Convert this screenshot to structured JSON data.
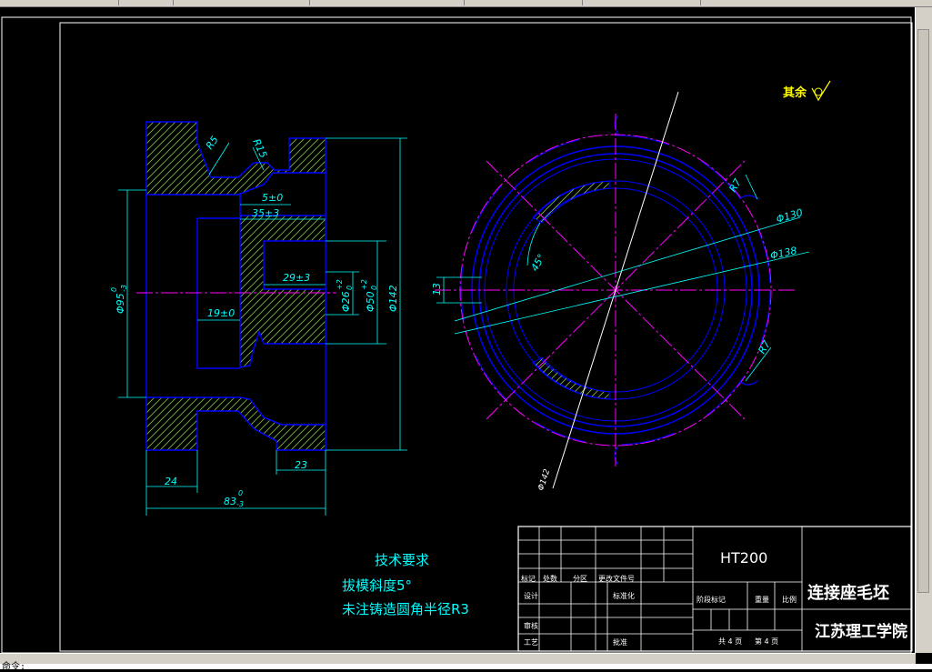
{
  "roughness": {
    "label": "其余"
  },
  "section_view": {
    "radius_labels": [
      "R5",
      "R15"
    ],
    "dims": {
      "d5": "5±0",
      "d35": "35±3",
      "d29": "29±3",
      "d19": "19±0",
      "d24": "24",
      "d23": "23",
      "d83": "83",
      "d83_tol": "0",
      "d83_tol2": "-3",
      "phi95": "Φ95",
      "phi95_tol": "0",
      "phi95_tol2": "-3",
      "phi26": "Φ26",
      "phi26_tol": "+2",
      "phi26_tol2": "0",
      "phi50": "Φ50",
      "phi50_tol": "+2",
      "phi50_tol2": "0",
      "phi142": "Φ142"
    }
  },
  "circle_view": {
    "r7_top": "R7",
    "r7_bottom": "R7",
    "phi130": "Φ130",
    "phi138": "Φ138",
    "phi142": "Φ142",
    "angle": "45°",
    "d13": "13"
  },
  "tech_req": {
    "title": "技术要求",
    "line1": "拔模斜度5°",
    "line2": "未注铸造圆角半径R3"
  },
  "title_block": {
    "material": "HT200",
    "part_name": "连接座毛坯",
    "school": "江苏理工学院",
    "row_labels": [
      "标记",
      "处数",
      "分区",
      "更改文件号"
    ],
    "design": "设计",
    "standard": "标准化",
    "review": "审核",
    "process": "工艺",
    "approve": "批准",
    "stage": "阶段标记",
    "weight": "重量",
    "scale": "比例",
    "total": "共 4 页",
    "sheet": "第 4 页"
  },
  "command_line": {
    "text": "命令:"
  }
}
